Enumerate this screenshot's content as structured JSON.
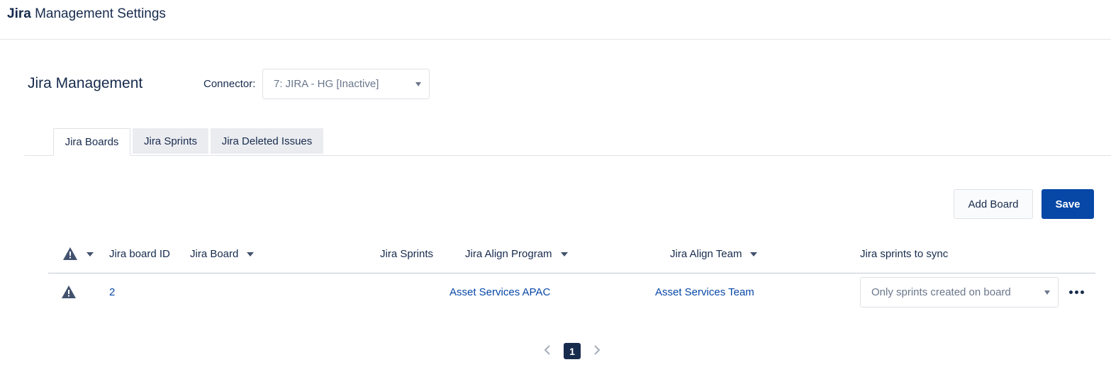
{
  "app": {
    "title_brand": "Jira",
    "title_rest": " Management Settings"
  },
  "section": {
    "title": "Jira Management"
  },
  "connector": {
    "label": "Connector:",
    "selected": "7: JIRA - HG [Inactive]"
  },
  "tabs": [
    {
      "label": "Jira Boards",
      "active": true
    },
    {
      "label": "Jira Sprints",
      "active": false
    },
    {
      "label": "Jira Deleted Issues",
      "active": false
    }
  ],
  "toolbar": {
    "add_board_label": "Add Board",
    "save_label": "Save"
  },
  "table": {
    "headers": {
      "board_id": "Jira board ID",
      "board": "Jira Board",
      "sprints": "Jira Sprints",
      "program": "Jira Align Program",
      "team": "Jira Align Team",
      "sync": "Jira sprints to sync"
    },
    "rows": [
      {
        "board_id": "2",
        "board": "",
        "sprints": "",
        "program": "Asset Services APAC",
        "team": "Asset Services Team",
        "sync": "Only sprints created on board"
      }
    ]
  },
  "pagination": {
    "current_page": "1"
  },
  "colors": {
    "primary": "#0747a6",
    "text": "#172b4d",
    "muted": "#6b778c"
  },
  "icons": {
    "warning": "warning-icon",
    "more": "more-icon",
    "prev": "chevron-left-icon",
    "next": "chevron-right-icon"
  }
}
